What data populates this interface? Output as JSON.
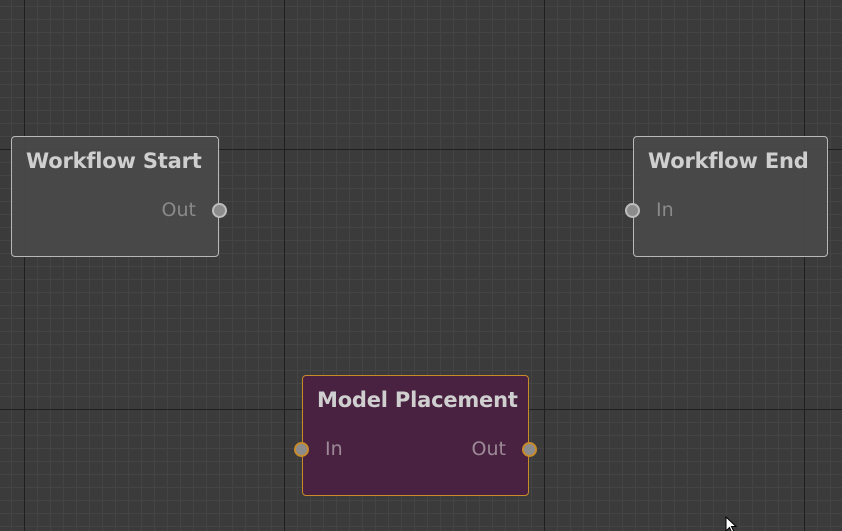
{
  "graph": {
    "nodes": [
      {
        "id": "workflow-start",
        "title": "Workflow Start",
        "ports": [
          {
            "label": "Out",
            "direction": "output"
          }
        ],
        "selected": false
      },
      {
        "id": "workflow-end",
        "title": "Workflow End",
        "ports": [
          {
            "label": "In",
            "direction": "input"
          }
        ],
        "selected": false
      },
      {
        "id": "model-placement",
        "title": "Model Placement",
        "ports": [
          {
            "label": "In",
            "direction": "input"
          },
          {
            "label": "Out",
            "direction": "output"
          }
        ],
        "selected": true
      }
    ]
  },
  "colors": {
    "canvas_background": "#3b3b3b",
    "grid_major": "#1f1f1f",
    "grid_minor": "#444444",
    "node_fill": "#4a4a4a",
    "node_border": "#b8b8b8",
    "selected_node_fill": "#4a2241",
    "selected_node_border": "#c98a2a",
    "title_text": "#cfcfcf",
    "port_text": "#8a8a8a"
  },
  "icons": {
    "cursor": "mouse-pointer-icon"
  }
}
